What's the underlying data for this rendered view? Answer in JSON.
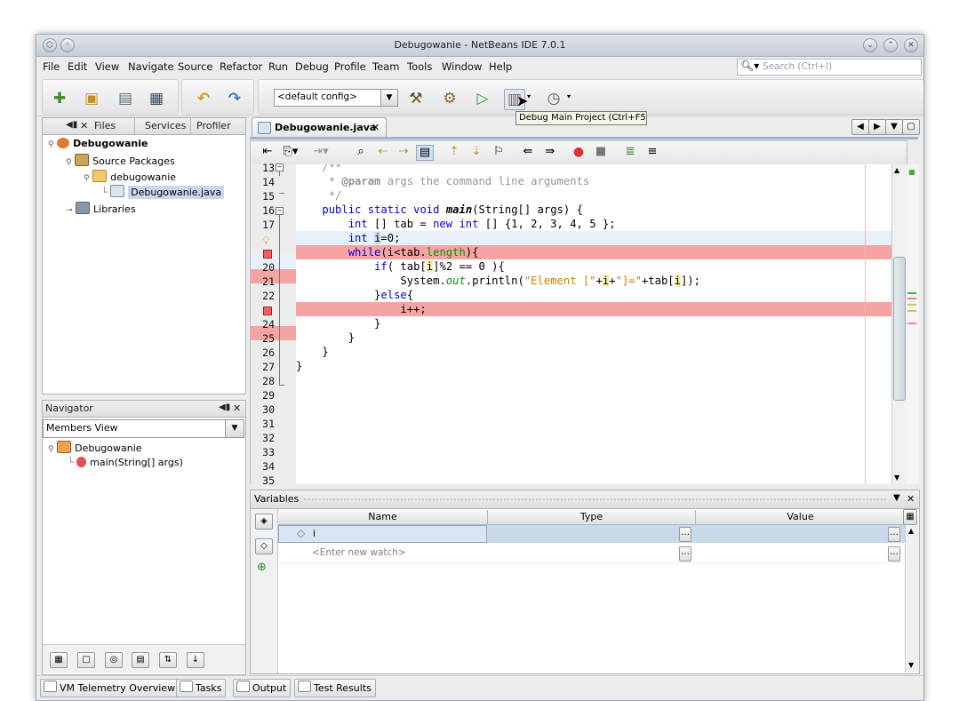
{
  "window": {
    "title": "Debugowanie - NetBeans IDE 7.0.1"
  },
  "menu": [
    "File",
    "Edit",
    "View",
    "Navigate",
    "Source",
    "Refactor",
    "Run",
    "Debug",
    "Profile",
    "Team",
    "Tools",
    "Window",
    "Help"
  ],
  "search": {
    "placeholder": "Search (Ctrl+I)"
  },
  "toolbar": {
    "config": "<default config>",
    "tooltip": "Debug Main Project (Ctrl+F5)"
  },
  "projects_panel": {
    "tabs": [
      "Files",
      "Services",
      "Profiler"
    ],
    "tree": [
      {
        "label": "Debugowanie",
        "level": 0
      },
      {
        "label": "Source Packages",
        "level": 1
      },
      {
        "label": "debugowanie",
        "level": 2
      },
      {
        "label": "Debugowanie.java",
        "level": 3
      },
      {
        "label": "Libraries",
        "level": 1
      }
    ]
  },
  "navigator": {
    "title": "Navigator",
    "view": "Members View",
    "items": [
      {
        "label": "Debugowanie",
        "level": 0
      },
      {
        "label": "main(String[] args)",
        "level": 1
      }
    ]
  },
  "editor": {
    "tab": "Debugowanie.java",
    "line_numbers": [
      "13",
      "14",
      "15",
      "16",
      "17",
      "",
      "",
      "20",
      "21",
      "22",
      "",
      "24",
      "25",
      "26",
      "27",
      "28",
      "29",
      "30",
      "31",
      "32",
      "33",
      "34",
      "35"
    ]
  },
  "variables": {
    "title": "Variables",
    "columns": [
      "Name",
      "Type",
      "Value"
    ],
    "rows": [
      {
        "name": "i",
        "type": "",
        "value": ""
      },
      {
        "name": "<Enter new watch>",
        "type": "",
        "value": ""
      }
    ]
  },
  "statusbar": {
    "buttons": [
      "VM Telemetry Overview",
      "Tasks",
      "Output",
      "Test Results"
    ]
  }
}
